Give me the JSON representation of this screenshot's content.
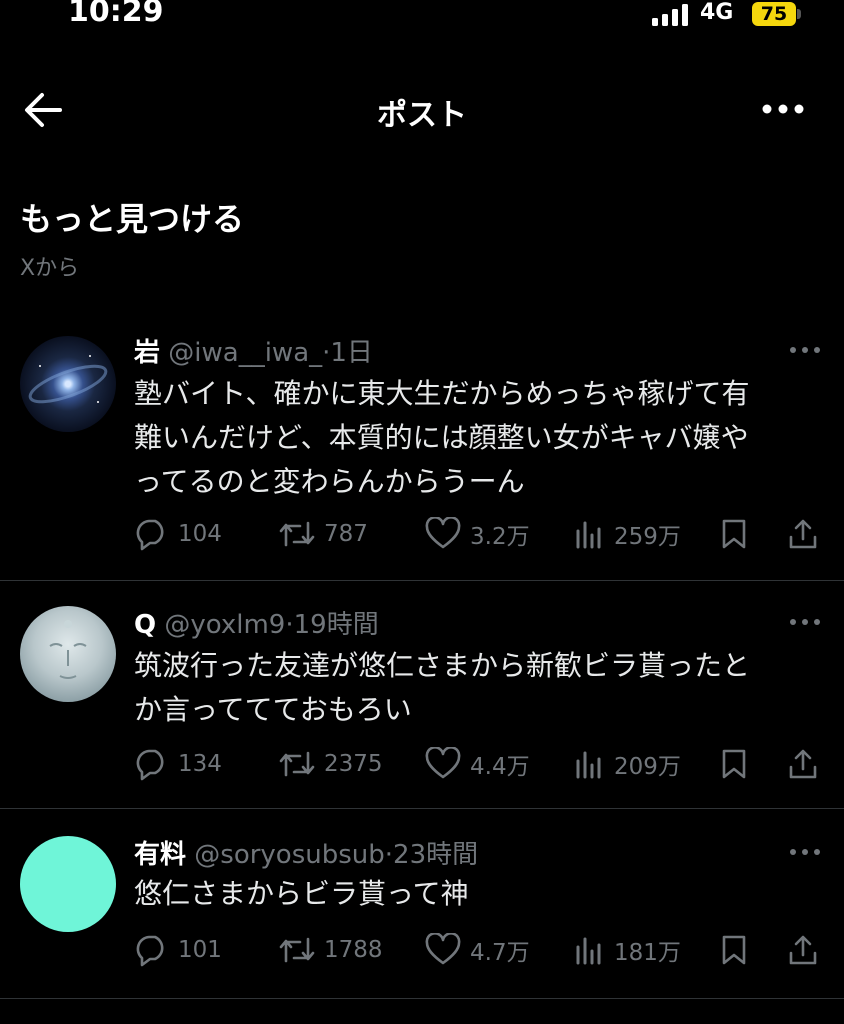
{
  "status": {
    "time": "10:29",
    "network": "4G",
    "battery": "75"
  },
  "header": {
    "title": "ポスト"
  },
  "section": {
    "title": "もっと見つける",
    "subtitle": "Xから"
  },
  "posts": [
    {
      "author": "岩",
      "handle": "@iwa__iwa_",
      "time": "1日",
      "lines": [
        "塾バイト、確かに東大生だからめっちゃ稼げて有",
        "難いんだけど、本質的には顔整い女がキャバ嬢や",
        "ってるのと変わらんからうーん"
      ],
      "replies": "104",
      "reposts": "787",
      "likes": "3.2万",
      "views": "259万"
    },
    {
      "author": "Q",
      "handle": "@yoxlm9",
      "time": "19時間",
      "lines": [
        "筑波行った友達が悠仁さまから新歓ビラ貰ったと",
        "か言っててておもろい"
      ],
      "replies": "134",
      "reposts": "2375",
      "likes": "4.4万",
      "views": "209万"
    },
    {
      "author": "有料",
      "handle": "@soryosubsub",
      "time": "23時間",
      "lines": [
        "悠仁さまからビラ貰って神"
      ],
      "replies": "101",
      "reposts": "1788",
      "likes": "4.7万",
      "views": "181万",
      "avatar_color": "#6ff5d8"
    }
  ],
  "separator": "·",
  "icons": [
    "back-arrow-icon",
    "more-icon",
    "reply-icon",
    "repost-icon",
    "like-icon",
    "views-icon",
    "bookmark-icon",
    "share-icon"
  ]
}
